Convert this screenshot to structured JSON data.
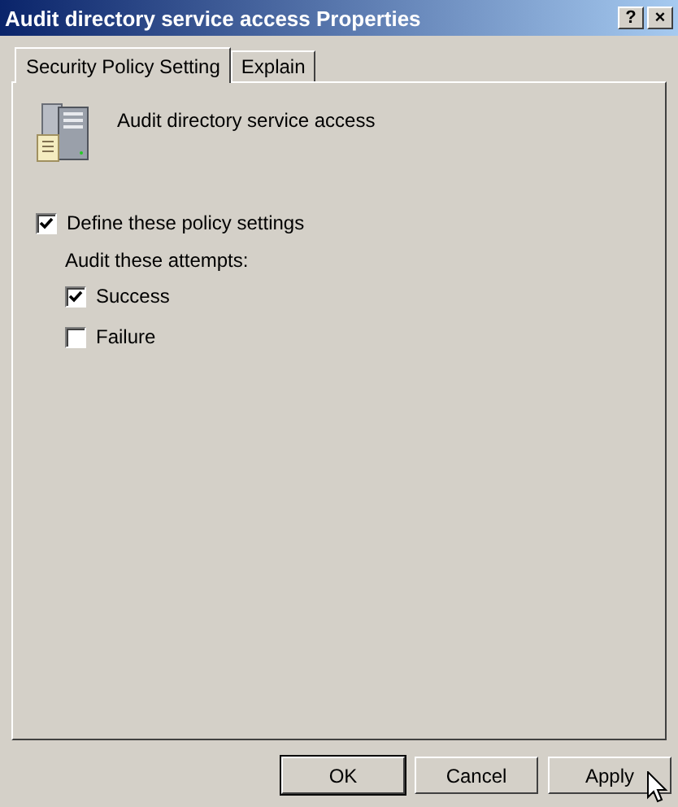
{
  "window": {
    "title": "Audit directory service access Properties",
    "title_buttons": [
      "?",
      "×"
    ]
  },
  "tabs": [
    {
      "label": "Security Policy Setting",
      "selected": true
    },
    {
      "label": "Explain",
      "selected": false
    }
  ],
  "policy": {
    "name": "Audit directory service access"
  },
  "define": {
    "label": "Define these policy settings",
    "checked": true
  },
  "attempts": {
    "label": "Audit these attempts:",
    "options": [
      {
        "label": "Success",
        "checked": true
      },
      {
        "label": "Failure",
        "checked": false
      }
    ]
  },
  "buttons": [
    "OK",
    "Cancel",
    "Apply"
  ]
}
